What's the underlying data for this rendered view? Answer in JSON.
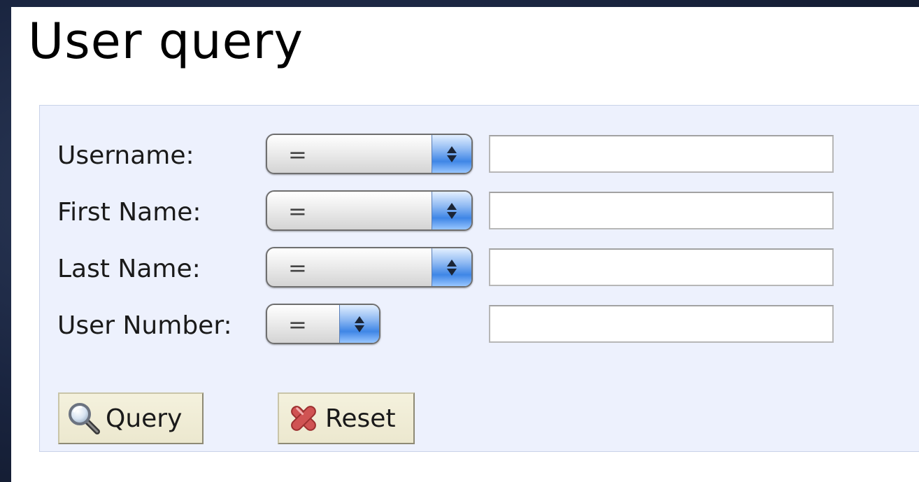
{
  "title": "User query",
  "fields": [
    {
      "label": "Username:",
      "operator": "=",
      "value": ""
    },
    {
      "label": "First Name:",
      "operator": "=",
      "value": ""
    },
    {
      "label": "Last Name:",
      "operator": "=",
      "value": ""
    },
    {
      "label": "User Number:",
      "operator": "=",
      "value": ""
    }
  ],
  "buttons": {
    "query_label": "Query",
    "query_icon": "magnifier-icon",
    "reset_label": "Reset",
    "reset_icon": "red-x-icon"
  },
  "colors": {
    "panel_background": "#edf1fd",
    "button_background": "#ece8cf",
    "select_arrow_blue": "#3f86e6",
    "reset_icon_red": "#d05353"
  }
}
